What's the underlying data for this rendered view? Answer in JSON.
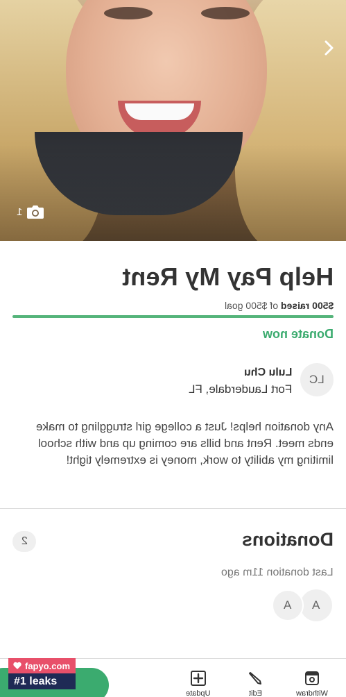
{
  "hero": {
    "photo_count": "1",
    "next_icon": "chevron-right-icon",
    "camera_icon": "camera-icon"
  },
  "campaign": {
    "title": "Help Pay My Rent",
    "raised_amount": "$500 raised",
    "goal_text": "of $500 goal",
    "progress": 1.0,
    "donate_label": "Donate now",
    "accent_color": "#3bab6f"
  },
  "organizer": {
    "initials": "LC",
    "name": "Lulu Chu",
    "location": "Fort Lauderdale, FL"
  },
  "story": "Any donation helps! Just a college girl struggling to make ends meet. Rent and bills are coming up and with school limiting my ability to work, money is extremely tight!",
  "donations": {
    "title": "Donations",
    "count": "2",
    "last_donation": "Last donation 11m ago",
    "donors": [
      "A",
      "A"
    ]
  },
  "bottom_bar": {
    "withdraw_label": "Withdraw",
    "edit_label": "Edit",
    "update_label": "Update"
  },
  "watermark": {
    "site": "fapyo.com",
    "tagline": "#1 leaks"
  }
}
